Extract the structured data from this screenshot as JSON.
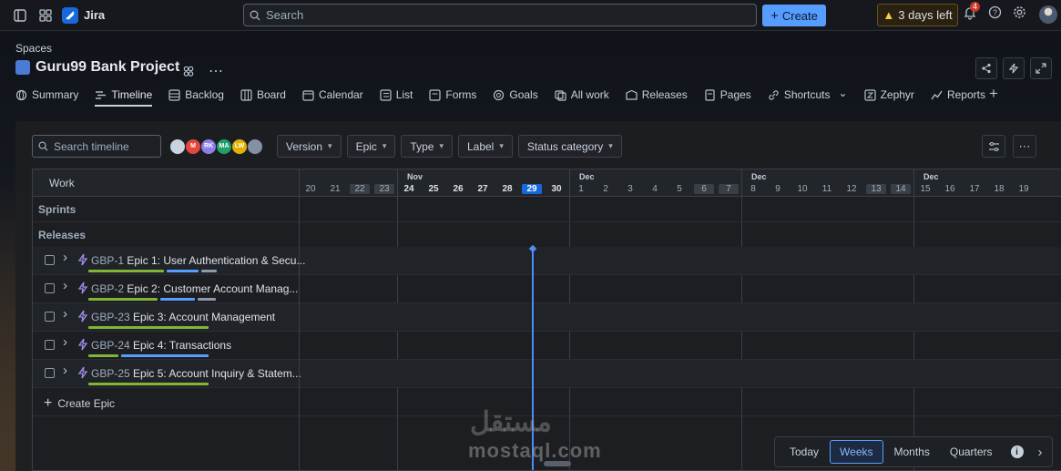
{
  "topbar": {
    "app_name": "Jira",
    "search_placeholder": "Search",
    "create_label": "Create",
    "trial_label": "3 days left",
    "notification_count": "4"
  },
  "project": {
    "breadcrumb": "Spaces",
    "name": "Guru99 Bank Project"
  },
  "tabs": [
    {
      "label": "Summary",
      "icon": "globe-icon"
    },
    {
      "label": "Timeline",
      "icon": "timeline-icon",
      "active": true
    },
    {
      "label": "Backlog",
      "icon": "backlog-icon"
    },
    {
      "label": "Board",
      "icon": "board-icon"
    },
    {
      "label": "Calendar",
      "icon": "calendar-icon"
    },
    {
      "label": "List",
      "icon": "list-icon"
    },
    {
      "label": "Forms",
      "icon": "forms-icon"
    },
    {
      "label": "Goals",
      "icon": "goals-icon"
    },
    {
      "label": "All work",
      "icon": "all-work-icon"
    },
    {
      "label": "Releases",
      "icon": "releases-icon"
    },
    {
      "label": "Pages",
      "icon": "pages-icon"
    },
    {
      "label": "Shortcuts",
      "icon": "link-icon"
    },
    {
      "label": "Zephyr",
      "icon": "zephyr-icon"
    },
    {
      "label": "Reports",
      "icon": "reports-icon"
    }
  ],
  "filters": {
    "search_placeholder": "Search timeline",
    "avatars": [
      {
        "initials": "",
        "color": "#c9d4e0"
      },
      {
        "initials": "M",
        "color": "#e2483d"
      },
      {
        "initials": "RK",
        "color": "#8f7ee7"
      },
      {
        "initials": "MA",
        "color": "#22a06b"
      },
      {
        "initials": "LW",
        "color": "#e2b203"
      },
      {
        "initials": "",
        "color": "#8590a2"
      }
    ],
    "dropdowns": [
      "Version",
      "Epic",
      "Type",
      "Label",
      "Status category"
    ]
  },
  "timeline": {
    "header_label": "Work",
    "rows": [
      "Sprints",
      "Releases"
    ],
    "months": [
      {
        "label": "Nov"
      },
      {
        "label": "Dec"
      },
      {
        "label": "Dec"
      },
      {
        "label": "Dec"
      }
    ],
    "days": [
      "20",
      "21",
      "22",
      "23",
      "24",
      "25",
      "26",
      "27",
      "28",
      "29",
      "30",
      "1",
      "2",
      "3",
      "4",
      "5",
      "6",
      "7",
      "8",
      "9",
      "10",
      "11",
      "12",
      "13",
      "14",
      "15",
      "16",
      "17",
      "18",
      "19"
    ],
    "today": "29",
    "weekend_days": [
      "22",
      "23",
      "6",
      "7",
      "13",
      "14"
    ],
    "epics": [
      {
        "key": "GBP-1",
        "title": "Epic 1: User Authentication & Secu...",
        "progress": [
          {
            "color": "#82b536",
            "value": 0.5
          },
          {
            "color": "#579dff",
            "value": 0.21
          },
          {
            "color": "#8c9bab",
            "value": 0.1
          }
        ]
      },
      {
        "key": "GBP-2",
        "title": "Epic 2: Customer Account Manag...",
        "progress": [
          {
            "color": "#82b536",
            "value": 0.46
          },
          {
            "color": "#579dff",
            "value": 0.23
          },
          {
            "color": "#8c9bab",
            "value": 0.12
          }
        ]
      },
      {
        "key": "GBP-23",
        "title": "Epic 3: Account Management",
        "progress": [
          {
            "color": "#82b536",
            "value": 0.8
          }
        ]
      },
      {
        "key": "GBP-24",
        "title": "Epic 4: Transactions",
        "progress": [
          {
            "color": "#82b536",
            "value": 0.2
          },
          {
            "color": "#579dff",
            "value": 0.58
          }
        ]
      },
      {
        "key": "GBP-25",
        "title": "Epic 5: Account Inquiry & Statem...",
        "progress": [
          {
            "color": "#82b536",
            "value": 0.8
          }
        ]
      }
    ],
    "create_epic_label": "Create Epic"
  },
  "zoom": {
    "options": [
      "Today",
      "Weeks",
      "Months",
      "Quarters"
    ],
    "selected": "Weeks"
  },
  "watermark": {
    "latin": "mostaql.com",
    "arabic": "مستقل"
  }
}
